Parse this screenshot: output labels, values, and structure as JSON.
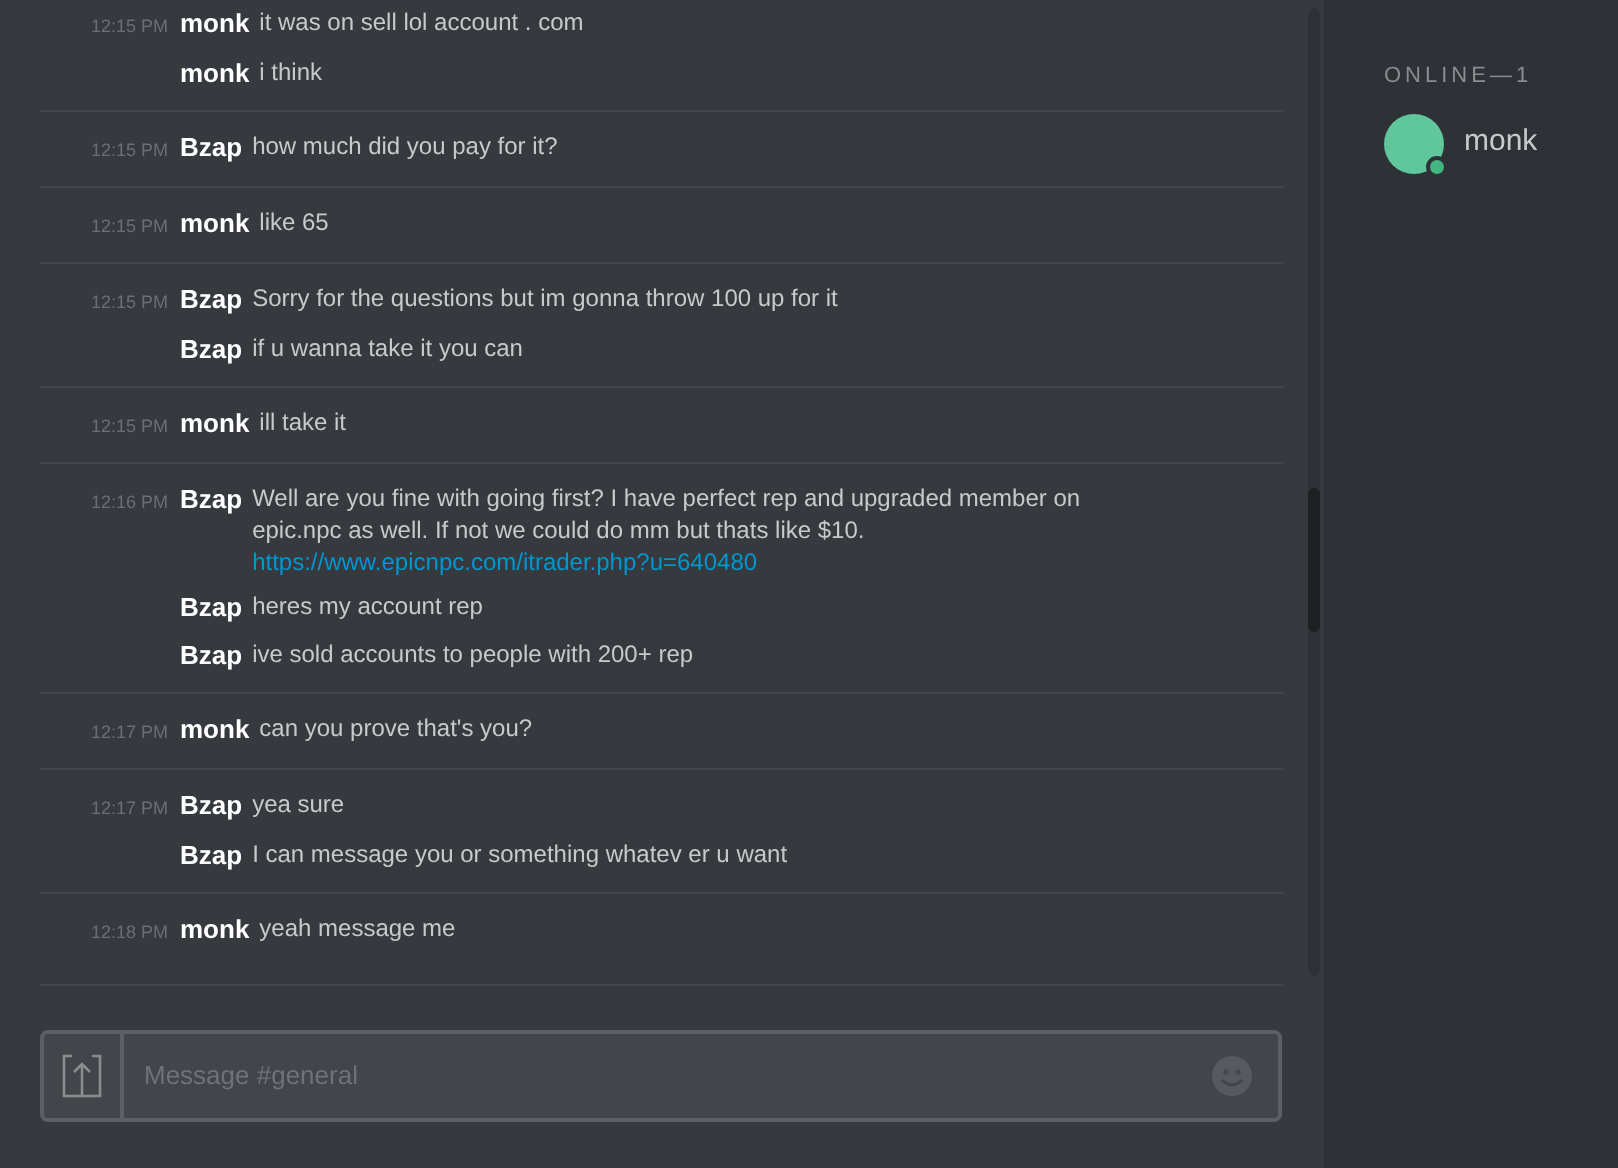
{
  "chat": {
    "groups": [
      {
        "time": "12:15 PM",
        "messages": [
          {
            "author": "monk",
            "text": "it was on sell lol account . com"
          },
          {
            "author": "monk",
            "text": "i think"
          }
        ]
      },
      {
        "time": "12:15 PM",
        "messages": [
          {
            "author": "Bzap",
            "text": "how much did you pay for it?"
          }
        ]
      },
      {
        "time": "12:15 PM",
        "messages": [
          {
            "author": "monk",
            "text": "like 65"
          }
        ]
      },
      {
        "time": "12:15 PM",
        "messages": [
          {
            "author": "Bzap",
            "text": "Sorry for the questions but im gonna throw 100 up for it"
          },
          {
            "author": "Bzap",
            "text": "if u wanna take it you can"
          }
        ]
      },
      {
        "time": "12:15 PM",
        "messages": [
          {
            "author": "monk",
            "text": "ill take it"
          }
        ]
      },
      {
        "time": "12:16 PM",
        "messages": [
          {
            "author": "Bzap",
            "text": "Well are you fine with going first? I have perfect rep and upgraded member on epic.npc as well. If not we could do mm but thats like $10.",
            "link": "https://www.epicnpc.com/itrader.php?u=640480"
          },
          {
            "author": "Bzap",
            "text": "heres my account rep"
          },
          {
            "author": "Bzap",
            "text": "ive sold accounts to people with 200+ rep"
          }
        ]
      },
      {
        "time": "12:17 PM",
        "messages": [
          {
            "author": "monk",
            "text": "can you prove that's you?"
          }
        ]
      },
      {
        "time": "12:17 PM",
        "messages": [
          {
            "author": "Bzap",
            "text": "yea sure"
          },
          {
            "author": "Bzap",
            "text": "I can message you or something whatev er u want"
          }
        ]
      },
      {
        "time": "12:18 PM",
        "messages": [
          {
            "author": "monk",
            "text": "yeah message me"
          }
        ]
      }
    ]
  },
  "composer": {
    "placeholder": "Message #general"
  },
  "members": {
    "heading": "ONLINE—1",
    "users": [
      {
        "name": "monk",
        "online": true
      }
    ]
  }
}
